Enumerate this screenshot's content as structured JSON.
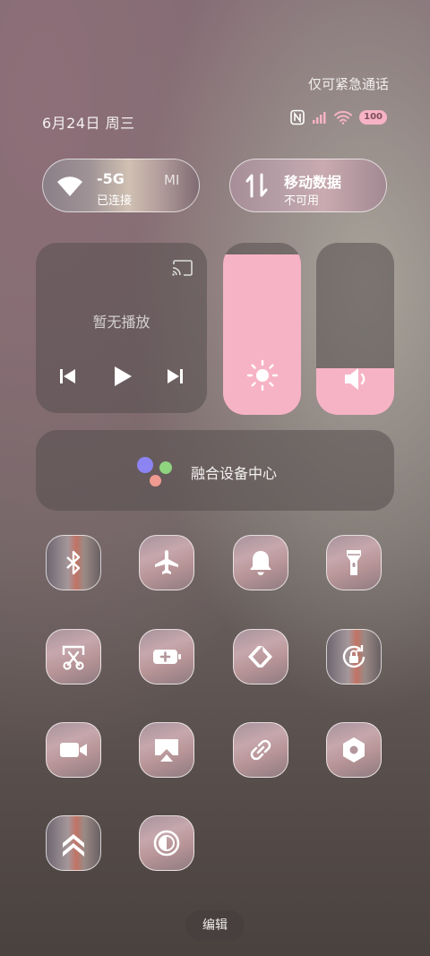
{
  "status_bar": {
    "emergency_text": "仅可紧急通话",
    "date": "6月24日 周三",
    "battery": "100",
    "icons": [
      "nfc-icon",
      "signal-icon",
      "wifi-icon",
      "battery-icon"
    ]
  },
  "wifi_tile": {
    "network_fragment": "-5G",
    "status": "已连接",
    "extra": "MI",
    "icon": "wifi-icon"
  },
  "data_tile": {
    "title": "移动数据",
    "status": "不可用",
    "icon": "data-arrows-icon"
  },
  "media": {
    "title": "暂无播放",
    "icons": [
      "cast-icon",
      "previous-icon",
      "play-icon",
      "next-icon"
    ]
  },
  "brightness": {
    "level": 0.93,
    "icon": "sun-icon"
  },
  "volume": {
    "level": 0.27,
    "icon": "speaker-icon"
  },
  "fusion": {
    "label": "融合设备中心",
    "colors": [
      "#8c84f2",
      "#8fd47e",
      "#f09b91"
    ]
  },
  "toggles": [
    {
      "name": "bluetooth",
      "icon": "bluetooth-icon"
    },
    {
      "name": "airplane",
      "icon": "airplane-icon"
    },
    {
      "name": "ringer",
      "icon": "bell-icon"
    },
    {
      "name": "flashlight",
      "icon": "flashlight-icon"
    },
    {
      "name": "screenshot",
      "icon": "scissors-icon"
    },
    {
      "name": "battery-saver",
      "icon": "battery-plus-icon"
    },
    {
      "name": "continuity",
      "icon": "chevron-link-icon"
    },
    {
      "name": "rotation-lock",
      "icon": "rotation-lock-icon"
    },
    {
      "name": "screen-record",
      "icon": "video-camera-icon"
    },
    {
      "name": "cast-screen",
      "icon": "screen-cast-icon"
    },
    {
      "name": "connect",
      "icon": "link-icon"
    },
    {
      "name": "settings",
      "icon": "hex-nut-icon"
    },
    {
      "name": "performance",
      "icon": "double-chevron-up-icon"
    },
    {
      "name": "dark-mode",
      "icon": "contrast-icon"
    }
  ],
  "edit_button": "编辑",
  "accent": "#f7b3c6"
}
